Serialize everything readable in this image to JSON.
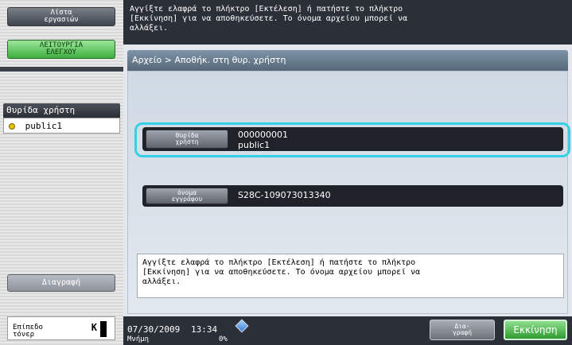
{
  "sidebar": {
    "jobs_label": "Λίστα\nεργασιών",
    "utility_label": "ΛΕΙΤΟΥΡΓΙΑ\nΕΛΕΓΧΟΥ",
    "userbox_title": "Θυρίδα χρήστη",
    "userbox_items": [
      {
        "label": "public1"
      }
    ],
    "delete_label": "Διαγραφή",
    "toner_label": "Επίπεδο\nτόνερ",
    "toner_color": "K"
  },
  "header": {
    "message": "Αγγίξτε ελαφρά το πλήκτρο [Εκτέλεση] ή πατήστε το πλήκτρο\n[Εκκίνηση] για να αποθηκεύσετε. Το όνομα αρχείου μπορεί να\nαλλάξει."
  },
  "breadcrumb": "Αρχείο > Αποθήκ. στη θυρ. χρήστη",
  "form": {
    "user_box": {
      "button_label": "Θυρίδα\nχρήστη",
      "number": "000000001",
      "name": "public1"
    },
    "document_name": {
      "button_label": "όνομα\nεγγράφου",
      "value": "S28C-109073013340"
    },
    "info_text": "Αγγίξτε ελαφρά το πλήκτρο [Εκτέλεση] ή πατήστε το πλήκτρο\n[Εκκίνηση] για να αποθηκεύσετε. Το όνομα αρχείου μπορεί να\nαλλάξει."
  },
  "status": {
    "date": "07/30/2009",
    "time": "13:34",
    "memory_label": "Μνήμη",
    "memory_value": "0%",
    "scroll_label": "Δια-\nγραφή",
    "start_label": "Εκκίνηση"
  },
  "colors": {
    "accent_green": "#3fae3f",
    "highlight_cyan": "#36d0e6",
    "dark_bar": "#2b2f37"
  }
}
